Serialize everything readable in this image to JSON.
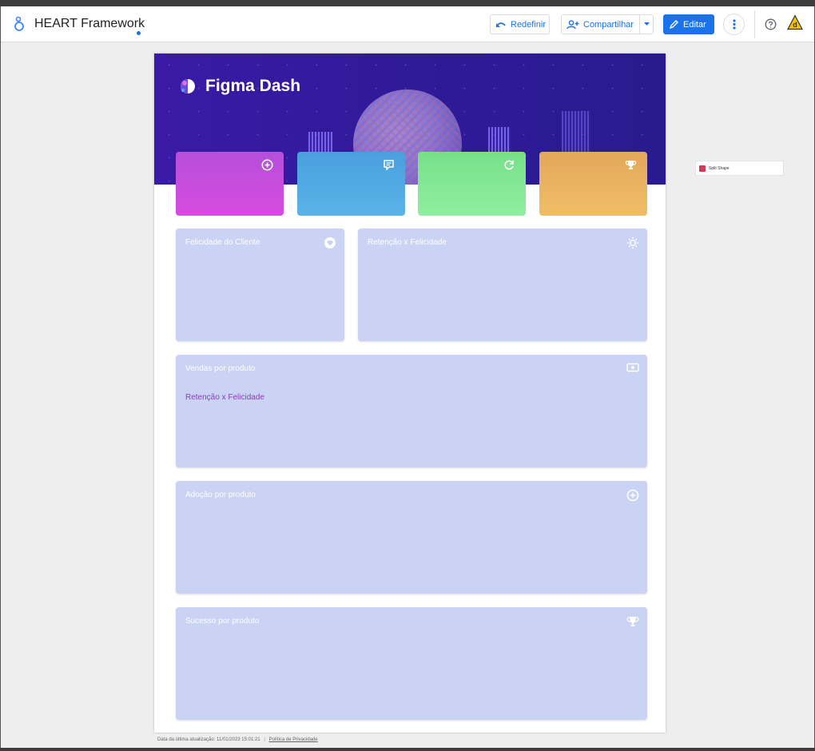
{
  "header": {
    "app_title": "HEART Framework",
    "buttons": {
      "redefinir": "Redefinir",
      "compartilhar": "Compartilhar",
      "editar": "Editar"
    }
  },
  "report": {
    "banner_title": "Figma Dash",
    "kpis": [
      {
        "icon": "plus-circle-icon",
        "color": "#c94fdc"
      },
      {
        "icon": "chat-icon",
        "color": "#52a9e3"
      },
      {
        "icon": "refresh-icon",
        "color": "#86e896"
      },
      {
        "icon": "trophy-icon",
        "color": "#ebb460"
      }
    ],
    "cards": {
      "felicidade": {
        "title": "Felicidade do Cliente",
        "icon": "heart-circle-icon"
      },
      "retencao": {
        "title": "Retenção x Felicidade",
        "icon": "sun-icon"
      },
      "vendas": {
        "title": "Vendas por produto",
        "subtitle": "Retenção x Felicidade",
        "icon": "money-icon"
      },
      "adocao": {
        "title": "Adoção por produto",
        "icon": "plus-circle-icon"
      },
      "sucesso": {
        "title": "Sucesso por produto",
        "icon": "trophy-icon"
      }
    }
  },
  "footer": {
    "last_update": "Data da última atualização: 11/01/2023 15:01:21",
    "separator": "|",
    "privacy_link": "Política de Privacidade"
  },
  "extension": {
    "label": "Split Shape"
  },
  "colors": {
    "accent": "#1a73e8",
    "card_bg": "#cad3f3",
    "banner_bg": "#2f1a98"
  }
}
